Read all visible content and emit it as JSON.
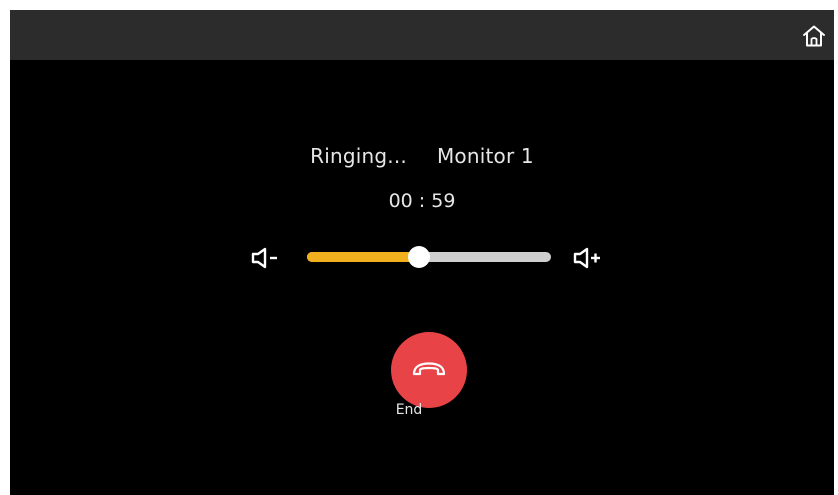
{
  "call": {
    "status": "Ringing...",
    "target": "Monitor 1",
    "timer": "00 : 59"
  },
  "volume": {
    "level": 0.46,
    "fill_color": "#f2b01e",
    "track_color": "#cfcfcf"
  },
  "actions": {
    "end_label": "End",
    "end_color": "#e84448"
  },
  "icons": {
    "home": "home-icon",
    "volume_down": "volume-down-icon",
    "volume_up": "volume-up-icon",
    "end_call": "phone-hangup-icon"
  }
}
